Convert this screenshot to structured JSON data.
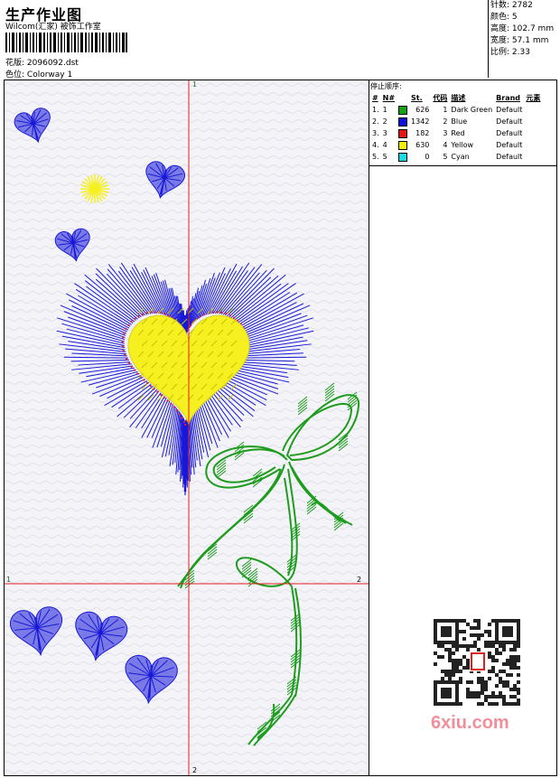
{
  "header": {
    "title": "生产作业图",
    "subtitle": "Wilcom(汇家) 被饰工作室",
    "design_label": "花版:",
    "design_value": "2096092.dst",
    "colorway_label": "色位:",
    "colorway_value": "Colorway 1"
  },
  "stats": [
    {
      "label": "针数:",
      "value": "2782"
    },
    {
      "label": "颜色:",
      "value": "5"
    },
    {
      "label": "高度:",
      "value": "102.7 mm"
    },
    {
      "label": "宽度:",
      "value": "57.1 mm"
    },
    {
      "label": "比例:",
      "value": "2.33"
    }
  ],
  "stop_sequence": {
    "title": "停止顺序:",
    "headers": [
      "#",
      "N#",
      "St.",
      "代码",
      "描述",
      "Brand",
      "元素"
    ],
    "rows": [
      {
        "idx": "1.",
        "n": "1",
        "color": "#16a016",
        "st": "626",
        "code": "1",
        "desc": "Dark Green",
        "brand": "Default"
      },
      {
        "idx": "2.",
        "n": "2",
        "color": "#1010d8",
        "st": "1342",
        "code": "2",
        "desc": "Blue",
        "brand": "Default"
      },
      {
        "idx": "3.",
        "n": "3",
        "color": "#e01818",
        "st": "182",
        "code": "3",
        "desc": "Red",
        "brand": "Default"
      },
      {
        "idx": "4.",
        "n": "4",
        "color": "#f4ee10",
        "st": "630",
        "code": "4",
        "desc": "Yellow",
        "brand": "Default"
      },
      {
        "idx": "5.",
        "n": "5",
        "color": "#20d8e0",
        "st": "0",
        "code": "5",
        "desc": "Cyan",
        "brand": "Default"
      }
    ]
  },
  "axis_labels": {
    "top": "1",
    "bottom": "2",
    "left": "1",
    "right": "2"
  },
  "watermark": "6xiu.com",
  "colors": {
    "guide": "#e02020",
    "stem": "#1e9c1e",
    "heart": "#1818d8",
    "fill": "#f6f020",
    "outline": "#e02040"
  }
}
